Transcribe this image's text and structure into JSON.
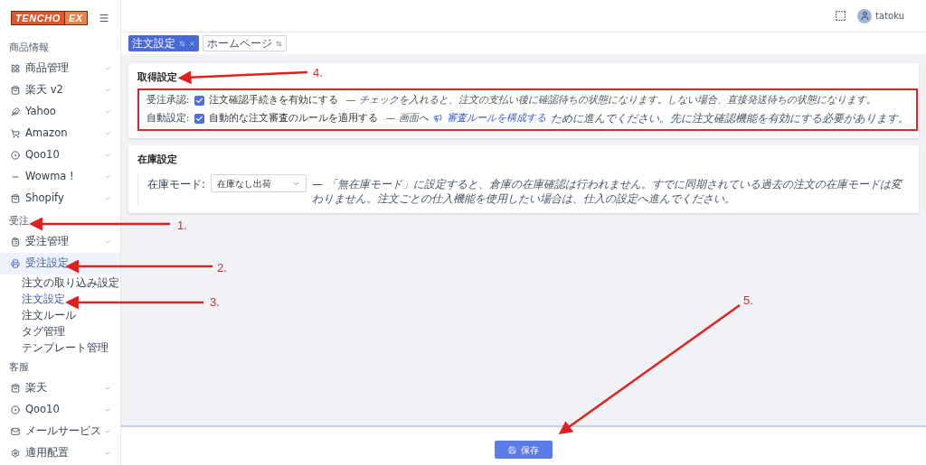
{
  "logo": {
    "left": "TENCHO",
    "right": "EX"
  },
  "header": {
    "user": "tatoku"
  },
  "sidebar": [
    {
      "heading": "商品情報",
      "items": [
        {
          "label": "商品管理",
          "selected": false,
          "expanded": false
        },
        {
          "label": "楽天 v2",
          "selected": false,
          "expanded": false
        },
        {
          "label": "Yahoo",
          "selected": false,
          "expanded": false
        },
        {
          "label": "Amazon",
          "selected": false,
          "expanded": false
        },
        {
          "label": "Qoo10",
          "selected": false,
          "expanded": false
        },
        {
          "label": "Wowma !",
          "selected": false,
          "expanded": false
        },
        {
          "label": "Shopify",
          "selected": false,
          "expanded": false
        }
      ]
    },
    {
      "heading": "受注",
      "items": [
        {
          "label": "受注管理",
          "selected": false,
          "expanded": false
        },
        {
          "label": "受注設定",
          "selected": true,
          "expanded": true,
          "children": [
            {
              "label": "注文の取り込み設定",
              "selected": false
            },
            {
              "label": "注文設定",
              "selected": true
            },
            {
              "label": "注文ルール",
              "selected": false
            },
            {
              "label": "タグ管理",
              "selected": false
            },
            {
              "label": "テンプレート管理",
              "selected": false
            }
          ]
        }
      ]
    },
    {
      "heading": "客服",
      "items": [
        {
          "label": "楽天",
          "selected": false,
          "expanded": false
        },
        {
          "label": "Qoo10",
          "selected": false,
          "expanded": false
        },
        {
          "label": "メールサービス",
          "selected": false,
          "expanded": false
        },
        {
          "label": "適用配置",
          "selected": false,
          "expanded": false
        }
      ]
    }
  ],
  "tabs": [
    {
      "label": "注文設定",
      "selected": true
    },
    {
      "label": "ホームページ",
      "selected": false
    }
  ],
  "acquisition": {
    "title": "取得設定",
    "highlighted": true,
    "rows": [
      {
        "label": "受注承認:",
        "option": "注文確認手続きを有効にする",
        "checked": true,
        "hint": "— チェックを入れると、注文の支払い後に確認待ちの状態になります。しない場合、直接発送待ちの状態になります。"
      },
      {
        "label": "自動設定:",
        "option": "自動的な注文審査のルールを適用する",
        "checked": true,
        "hint_before": "— 画面へ",
        "link": "審査ルールを構成する",
        "hint_after": "ために進んでください。先に注文確認機能を有効にする必要があります。"
      }
    ]
  },
  "stock": {
    "title": "在庫設定",
    "label": "在庫モード:",
    "value": "在庫なし出荷",
    "hint": "— 「無在庫モード」に設定すると、倉庫の在庫確認は行われません。すでに同期されている過去の注文の在庫モードは変わりません。注文ごとの仕入機能を使用したい場合は、仕入の設定へ進んでください。"
  },
  "save_button": "保存",
  "annotations": [
    "1.",
    "2.",
    "3.",
    "4.",
    "5."
  ]
}
